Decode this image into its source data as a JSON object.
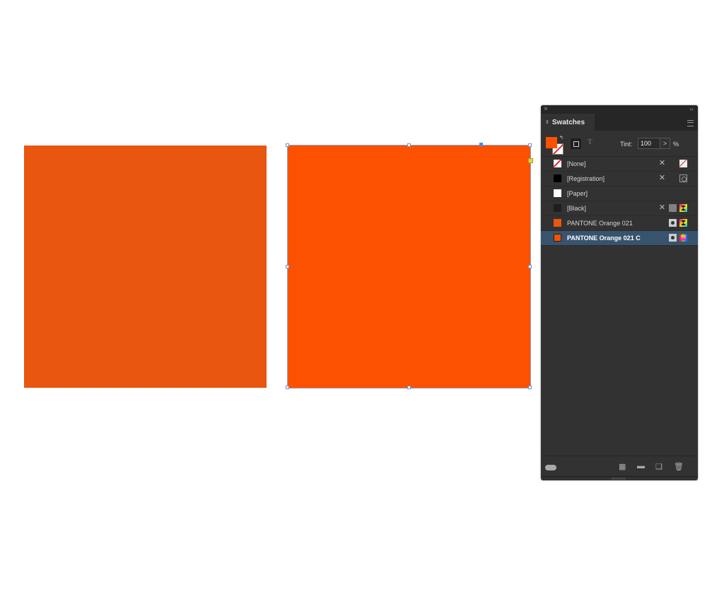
{
  "canvas": {
    "left_rect": {
      "fill": "#e8560f",
      "label": "PANTONE Orange 021"
    },
    "right_rect": {
      "fill": "#fd5102",
      "label": "PANTONE Orange 021 C",
      "selected": true
    }
  },
  "panel": {
    "close_icon": "×",
    "collapse_icon": "‹‹",
    "tab_arrows": "⇕",
    "title": "Swatches",
    "fill_color": "#fd5102",
    "swap_icon": "↰",
    "text_icon": "T",
    "tint_label": "Tint:",
    "tint_value": "100",
    "tint_stepper": ">",
    "tint_unit": "%",
    "swatches": [
      {
        "name": "[None]",
        "color": "none",
        "icons": [
          "no-edit-icon",
          "none-icon"
        ]
      },
      {
        "name": "[Registration]",
        "color": "#000000",
        "icons": [
          "no-edit-icon",
          "registration-icon"
        ]
      },
      {
        "name": "[Paper]",
        "color": "#ffffff",
        "icons": []
      },
      {
        "name": "[Black]",
        "color": "#1e1e1e",
        "icons": [
          "no-edit-icon",
          "process-icon",
          "cmyk-icon"
        ]
      },
      {
        "name": "PANTONE Orange 021",
        "color": "#e8560f",
        "icons": [
          "spot-icon",
          "cmyk-icon"
        ]
      },
      {
        "name": "PANTONE Orange 021 C",
        "color": "#fd5102",
        "icons": [
          "spot-icon",
          "rgb-icon"
        ],
        "selected": true
      }
    ],
    "footer": {
      "no_edit_glyph": "✕",
      "folder_glyph": "▬",
      "new_glyph": "❏",
      "trash_glyph": "🗑",
      "grid_glyph": "▦"
    }
  },
  "accent": {
    "selection": "#38536e",
    "handle": "#3d8ff0"
  }
}
